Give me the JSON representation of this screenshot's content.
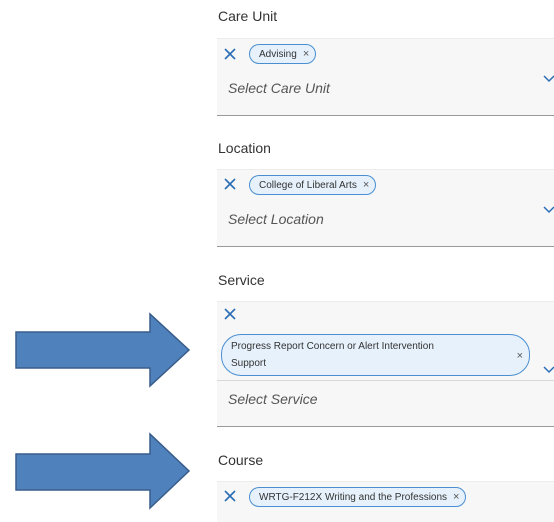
{
  "care_unit": {
    "label": "Care Unit",
    "chip": "Advising",
    "chip_remove": "×",
    "placeholder": "Select Care Unit"
  },
  "location": {
    "label": "Location",
    "chip": "College of Liberal Arts",
    "chip_remove": "×",
    "placeholder": "Select Location"
  },
  "service": {
    "label": "Service",
    "chip_line1": "Progress Report Concern or Alert Intervention",
    "chip_line2": "Support",
    "chip_remove": "×",
    "placeholder": "Select Service"
  },
  "course": {
    "label": "Course",
    "chip": "WRTG-F212X Writing and the Professions",
    "chip_remove": "×"
  },
  "icons": {
    "clear": "close-icon",
    "dropdown": "chevron-down-icon",
    "pointer": "arrow-right-icon"
  },
  "colors": {
    "accent": "#2a6db5",
    "chip_border": "#4a8fd1",
    "chip_bg": "#e6f1fb",
    "arrow_fill": "#4f81bd",
    "arrow_stroke": "#385d8a"
  }
}
